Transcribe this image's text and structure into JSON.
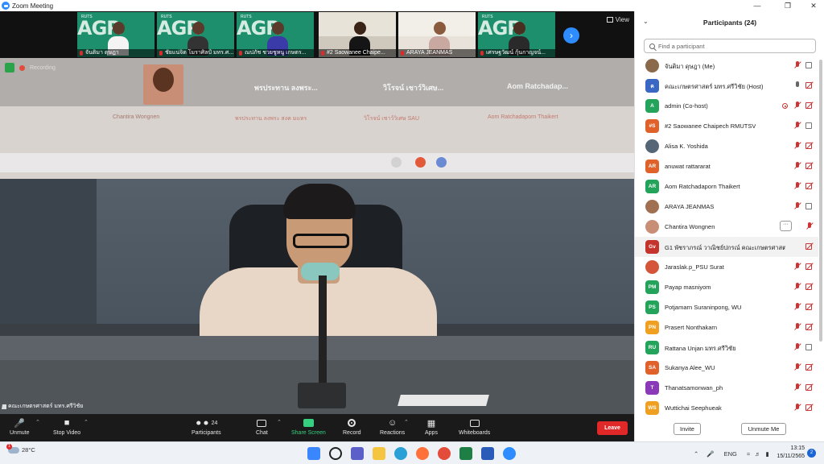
{
  "window": {
    "title": "Zoom Meeting"
  },
  "thumbnails": [
    {
      "name": "จันติมา ดุษฎา",
      "brand": "RUTS"
    },
    {
      "name": "ชัยแน่จิต โมราศิลป์ มทร.ศ...",
      "brand": "RUTS"
    },
    {
      "name": "ณปภัช ชวยชูหนู เกษตร...",
      "brand": "RUTS"
    },
    {
      "name": "#2 Saowanee Chaipe..."
    },
    {
      "name": "ARAYA JEANMAS"
    },
    {
      "name": "เศรษฐวัฒน์ กุ้นกาญจน์...",
      "brand": "RUTS"
    }
  ],
  "thumb_brand_letters": "AGR",
  "view_label": "View",
  "recording_label": "Recording",
  "shared_screen": {
    "tiles": [
      {
        "name": "Chantira Wongnen",
        "sub": "Chantira Wongnen"
      },
      {
        "name": "พรประทาน ลงพระ...",
        "sub": "พรประทาน ลงพระ สงค มแหร"
      },
      {
        "name": "วิโรจน์ เชาว์วิเศษ...",
        "sub": "วิโรจน์ เชาว์วิเศษ SAU"
      },
      {
        "name": "Aom Ratchadap...",
        "sub": "Aom Ratchadaporn Thaikert"
      }
    ]
  },
  "speaker_name": "คณะเกษตรศาสตร์ มทร.ศรีวิชัย",
  "toolbar": {
    "unmute": "Unmute",
    "stop_video": "Stop Video",
    "participants": "Participants",
    "participants_count": "24",
    "chat": "Chat",
    "share_screen": "Share Screen",
    "record": "Record",
    "reactions": "Reactions",
    "apps": "Apps",
    "whiteboards": "Whiteboards",
    "leave": "Leave"
  },
  "panel": {
    "title": "Participants (24)",
    "search_placeholder": "Find a participant",
    "invite": "Invite",
    "unmute_me": "Unmute Me"
  },
  "participants": [
    {
      "name": "จันติมา ดุษฎา (Me)",
      "avatar": "",
      "color": "#8a6a4a",
      "photo": true,
      "mic": "muted",
      "cam": "on"
    },
    {
      "name": "คณะเกษตรศาสตร์ มทร.ศรีวิชัย (Host)",
      "avatar": "ค",
      "color": "#3a66c4",
      "mic": "on",
      "cam": "off"
    },
    {
      "name": "admin (Co-host)",
      "avatar": "A",
      "color": "#24a35a",
      "mic": "muted",
      "cam": "off",
      "rec": true
    },
    {
      "name": "#2 Saowanee Chaipech RMUTSV",
      "avatar": "#S",
      "color": "#e0622a",
      "mic": "muted",
      "cam": "on"
    },
    {
      "name": "Alisa K. Yoshida",
      "avatar": "",
      "color": "#556677",
      "photo": true,
      "mic": "muted",
      "cam": "off"
    },
    {
      "name": "anuwat rattararat",
      "avatar": "AR",
      "color": "#e0622a",
      "mic": "muted",
      "cam": "off"
    },
    {
      "name": "Aom Ratchadaporn Thaikert",
      "avatar": "AR",
      "color": "#24a35a",
      "mic": "muted",
      "cam": "off"
    },
    {
      "name": "ARAYA JEANMAS",
      "avatar": "",
      "color": "#a07050",
      "photo": true,
      "mic": "muted",
      "cam": "on"
    },
    {
      "name": "Chantira Wongnen",
      "avatar": "",
      "color": "#c98f76",
      "photo": true,
      "mic": "muted",
      "cam": "none",
      "more": true
    },
    {
      "name": "G1 พัชราภรณ์ วาณิชย์ปกรณ์ คณะเกษตรศาสตร์",
      "avatar": "Gv",
      "color": "#c4342d",
      "mic": "none",
      "cam": "off",
      "hl": true
    },
    {
      "name": "Jaraslak.p_PSU Surat",
      "avatar": "",
      "color": "#d4553a",
      "photo": true,
      "mic": "muted",
      "cam": "off"
    },
    {
      "name": "Payap masniyom",
      "avatar": "PM",
      "color": "#24a35a",
      "mic": "muted",
      "cam": "off"
    },
    {
      "name": "Potjamarn Suraninpong, WU",
      "avatar": "PS",
      "color": "#24a35a",
      "mic": "muted",
      "cam": "off"
    },
    {
      "name": "Prasert Nonthakarn",
      "avatar": "PN",
      "color": "#f0a020",
      "mic": "muted",
      "cam": "off"
    },
    {
      "name": "Rattana Unjan มทร.ศรีวิชัย",
      "avatar": "RU",
      "color": "#24a35a",
      "mic": "muted",
      "cam": "on"
    },
    {
      "name": "Sukanya Alee_WU",
      "avatar": "SA",
      "color": "#e0622a",
      "mic": "muted",
      "cam": "off"
    },
    {
      "name": "Thanatsamonwan_ph",
      "avatar": "T",
      "color": "#8a3ab8",
      "mic": "muted",
      "cam": "off"
    },
    {
      "name": "Wuttichai Seephueak",
      "avatar": "WS",
      "color": "#f0a020",
      "mic": "muted",
      "cam": "off"
    }
  ],
  "taskbar": {
    "temperature": "28°C",
    "weather_badge": "1",
    "language": "ENG",
    "time": "13:15",
    "date": "15/11/2565",
    "notification_count": "2"
  }
}
